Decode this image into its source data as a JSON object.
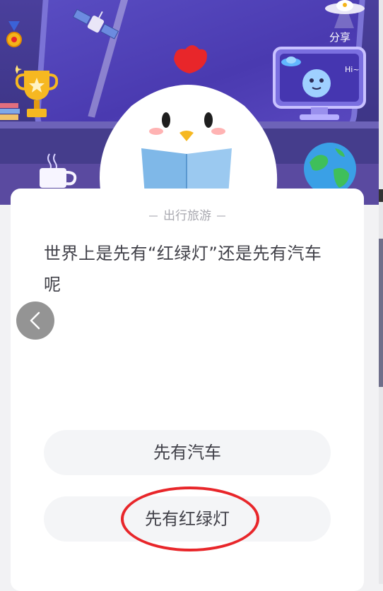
{
  "header": {
    "share_label": "分享",
    "monitor_text": "Hi~"
  },
  "quiz": {
    "category": "出行旅游",
    "question": "世界上是先有“红绿灯”还是先有汽车呢",
    "options": [
      {
        "label": "先有汽车",
        "highlighted": false
      },
      {
        "label": "先有红绿灯",
        "highlighted": true
      }
    ]
  },
  "icons": {
    "back": "chevron-left-icon",
    "share": "ufo-share-icon"
  },
  "colors": {
    "highlight_ring": "#e8262a",
    "option_bg": "#f4f5f7",
    "text": "#404048",
    "category": "#a9a9b0"
  }
}
